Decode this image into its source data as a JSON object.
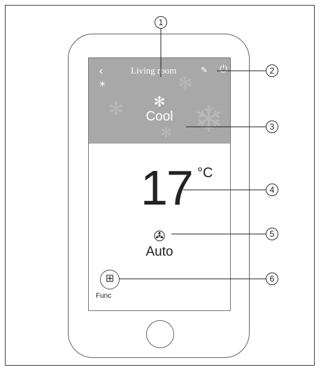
{
  "header": {
    "back_icon": "chevron-left-icon",
    "room_name": "Living room",
    "edit_icon": "pencil-icon",
    "power_icon": "power-icon",
    "light_icon": "light-icon"
  },
  "mode": {
    "icon": "snowflake-icon",
    "label": "Cool"
  },
  "temperature": {
    "value": "17",
    "unit": "°C"
  },
  "fan": {
    "icon": "fan-icon",
    "label": "Auto"
  },
  "func": {
    "icon": "grid-icon",
    "label": "Func"
  },
  "callouts": [
    "1",
    "2",
    "3",
    "4",
    "5",
    "6"
  ],
  "colors": {
    "header_bg": "#a8a8a8",
    "text_dark": "#222222",
    "outline": "#666666"
  }
}
